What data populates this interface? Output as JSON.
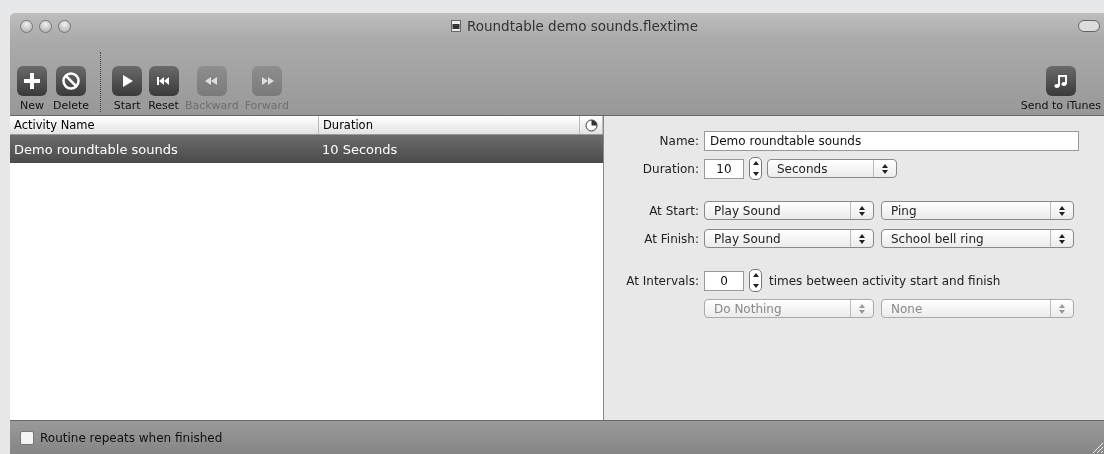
{
  "window": {
    "title": "Roundtable demo sounds.flextime"
  },
  "toolbar": {
    "groups": [
      [
        {
          "label": "New",
          "kind": "add",
          "disabled": false
        },
        {
          "label": "Delete",
          "kind": "delete",
          "disabled": false
        }
      ],
      [
        {
          "label": "Start",
          "kind": "play",
          "disabled": false
        },
        {
          "label": "Reset",
          "kind": "reset",
          "disabled": false
        },
        {
          "label": "Backward",
          "kind": "rewind",
          "disabled": true
        },
        {
          "label": "Forward",
          "kind": "forward",
          "disabled": true
        }
      ]
    ],
    "right": [
      {
        "label": "Send to iTunes",
        "kind": "music",
        "disabled": false
      }
    ]
  },
  "table": {
    "columns": [
      "Activity Name",
      "Duration"
    ],
    "rows": [
      {
        "cells": [
          "Demo roundtable sounds",
          "10 Seconds"
        ],
        "selected": true
      }
    ]
  },
  "form": {
    "name": {
      "label": "Name:",
      "value": "Demo roundtable sounds"
    },
    "duration": {
      "label": "Duration:",
      "value": "10",
      "unit": "Seconds"
    },
    "events": [
      {
        "label": "At Start:",
        "action": "Play Sound",
        "sound": "Ping"
      },
      {
        "label": "At Finish:",
        "action": "Play Sound",
        "sound": "School bell ring"
      }
    ],
    "intervals": {
      "label": "At Intervals:",
      "value": "0",
      "note": "times between activity start and finish",
      "action": "Do Nothing",
      "sound": "None",
      "disabled": true
    }
  },
  "status_bar": {
    "checkbox": {
      "label": "Routine repeats when finished",
      "checked": false
    }
  }
}
